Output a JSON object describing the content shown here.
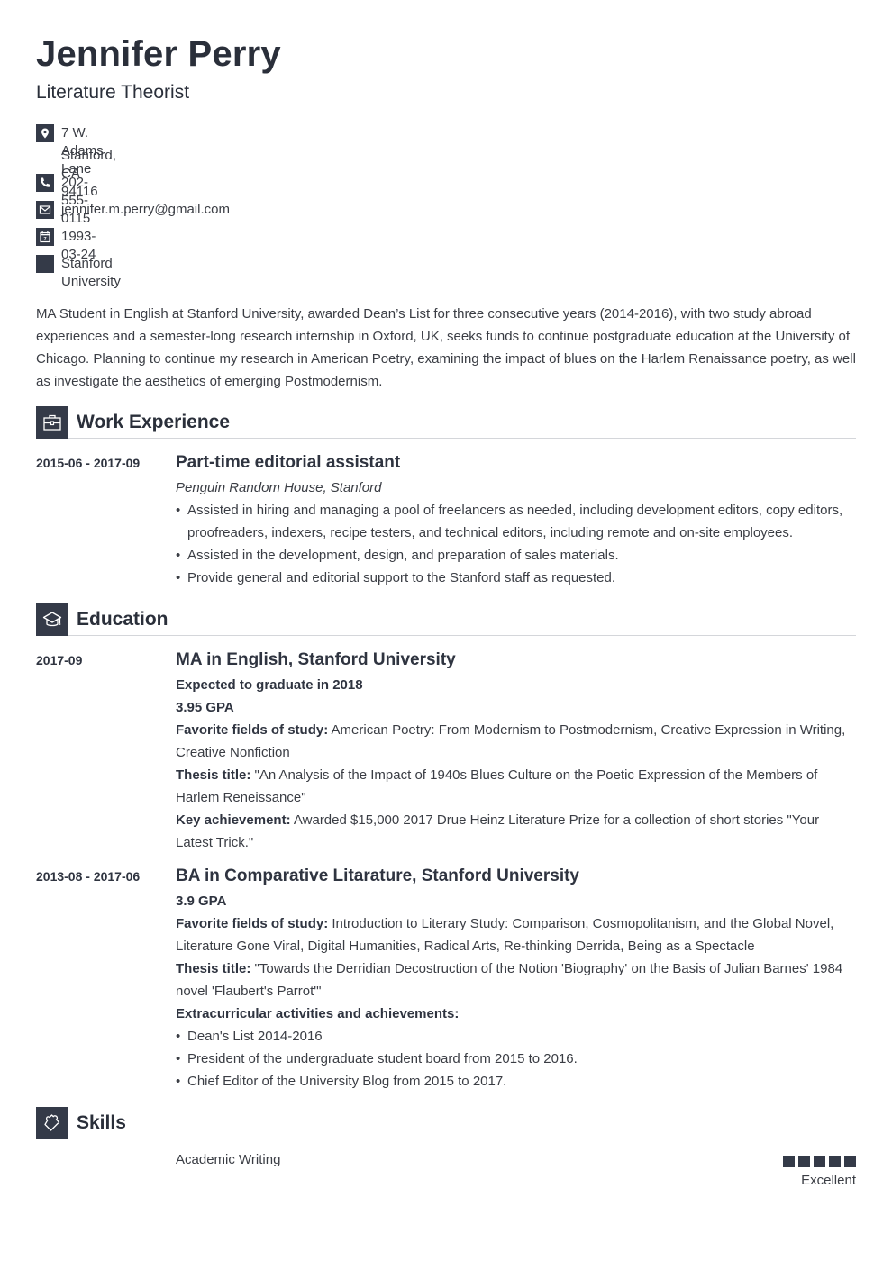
{
  "header": {
    "name": "Jennifer Perry",
    "title": "Literature Theorist"
  },
  "contact": {
    "address_line1": "7 W. Adams Lane",
    "address_line2": "Stanford, CA 94116",
    "phone": "202-555-0115",
    "email": "jennifer.m.perry@gmail.com",
    "dob": "1993-03-24",
    "university": "Stanford University",
    "icons": [
      "location-pin-icon",
      "phone-icon",
      "envelope-icon",
      "calendar-icon",
      "square-icon"
    ]
  },
  "summary": "MA Student in English at Stanford University, awarded Dean’s List for three consecutive years (2014-2016), with two study abroad experiences and a semester-long research internship in Oxford, UK, seeks funds to continue postgraduate education at the University of Chicago. Planning to continue my research in American Poetry, examining the impact of blues on the Harlem Renaissance poetry, as well as investigate the aesthetics of emerging Postmodernism.",
  "work": {
    "heading": "Work Experience",
    "icon": "briefcase-icon",
    "entries": [
      {
        "date": "2015-06 - 2017-09",
        "title": "Part-time editorial assistant",
        "company": "Penguin Random House, Stanford",
        "bullets": [
          "Assisted in hiring and managing a pool of freelancers as needed, including development editors, copy editors, proofreaders, indexers, recipe testers, and technical editors, including remote and on-site employees.",
          "Assisted in the development, design, and preparation of sales materials.",
          "Provide general and editorial support to the Stanford staff as requested."
        ]
      }
    ]
  },
  "education": {
    "heading": "Education",
    "icon": "graduation-cap-icon",
    "entries": [
      {
        "date": "2017-09",
        "title": "MA in English, Stanford University",
        "expected": "Expected to graduate in 2018",
        "gpa": "3.95 GPA",
        "fields_label": "Favorite fields of study:",
        "fields": "American Poetry: From Modernism to Postmodernism, Creative Expression in Writing, Creative Nonfiction",
        "thesis_label": "Thesis title:",
        "thesis": "\"An Analysis of the Impact of 1940s Blues Culture on the Poetic Expression of the Members of Harlem Reneissance\"",
        "achievement_label": "Key achievement:",
        "achievement": "Awarded $15,000 2017 Drue Heinz Literature Prize for a collection of short stories \"Your Latest Trick.\""
      },
      {
        "date": "2013-08 - 2017-06",
        "title": "BA in Comparative Litarature, Stanford University",
        "gpa": "3.9 GPA",
        "fields_label": "Favorite fields of study:",
        "fields": "Introduction to Literary Study: Comparison, Cosmopolitanism, and the Global Novel, Literature Gone Viral, Digital Humanities, Radical Arts, Re-thinking Derrida, Being as a Spectacle",
        "thesis_label": "Thesis title:",
        "thesis": "\"Towards the Derridian Decostruction of the Notion 'Biography' on the Basis of Julian Barnes' 1984 novel 'Flaubert's Parrot'\"",
        "extra_label": "Extracurricular activities and achievements:",
        "extra": [
          "Dean's List 2014-2016",
          "President of the undergraduate student board from 2015 to 2016.",
          "Chief Editor of the University Blog from 2015 to 2017."
        ]
      }
    ]
  },
  "skills": {
    "heading": "Skills",
    "icon": "puzzle-piece-icon",
    "items": [
      {
        "name": "Academic Writing",
        "rating": 5,
        "max": 5,
        "level": "Excellent"
      }
    ]
  },
  "colors": {
    "accent": "#343a48",
    "text": "#3a3d44",
    "heading": "#2a2f3a",
    "divider": "#d4d6da"
  }
}
